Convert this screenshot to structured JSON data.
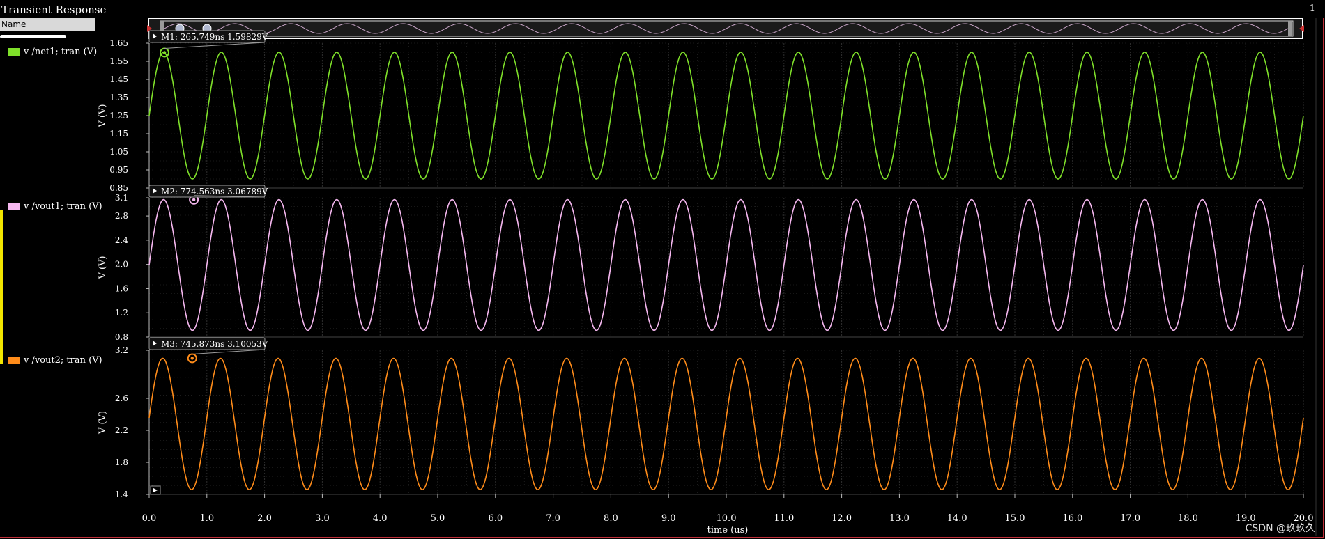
{
  "window": {
    "title": "Transient Response",
    "number": "1"
  },
  "panel": {
    "name_header": "Name"
  },
  "legend": [
    {
      "label": "v /net1; tran (V)",
      "color": "#7fe02a"
    },
    {
      "label": "v /vout1; tran (V)",
      "color": "#f6b8f0"
    },
    {
      "label": "v /vout2; tran (V)",
      "color": "#ff8c1a"
    }
  ],
  "watermark": "CSDN @玖玖久",
  "colors": {
    "grid": "#2e2e2e",
    "axis": "#bdbdbd",
    "frame": "#c0303a",
    "selection": "#f2e600"
  },
  "chart_data": {
    "type": "line",
    "xlabel": "time (us)",
    "xlim": [
      0.0,
      20.0
    ],
    "x_ticks": [
      "0.0",
      "1.0",
      "2.0",
      "3.0",
      "4.0",
      "5.0",
      "6.0",
      "7.0",
      "8.0",
      "9.0",
      "10.0",
      "11.0",
      "12.0",
      "13.0",
      "14.0",
      "15.0",
      "16.0",
      "17.0",
      "18.0",
      "19.0",
      "20.0"
    ],
    "x_tick_values": [
      0,
      1,
      2,
      3,
      4,
      5,
      6,
      7,
      8,
      9,
      10,
      11,
      12,
      13,
      14,
      15,
      16,
      17,
      18,
      19,
      20
    ],
    "grid": true,
    "panels": [
      {
        "ylabel": "V (V)",
        "ylim": [
          0.85,
          1.65
        ],
        "y_ticks": [
          "1.65",
          "1.55",
          "1.45",
          "1.35",
          "1.25",
          "1.15",
          "1.05",
          "0.95",
          "0.85"
        ],
        "y_tick_values": [
          1.65,
          1.55,
          1.45,
          1.35,
          1.25,
          1.15,
          1.05,
          0.95,
          0.85
        ],
        "series": {
          "color": "#7fe02a",
          "offset": 1.25,
          "amplitude": 0.35,
          "period_us": 1.0,
          "phase_us": 0.0
        },
        "marker": {
          "label": "M1: 265.749ns 1.59829V",
          "x_us": 0.265749,
          "y": 1.59829
        }
      },
      {
        "ylabel": "V (V)",
        "ylim": [
          0.8,
          3.1
        ],
        "y_ticks": [
          "3.1",
          "2.8",
          "2.4",
          "2.0",
          "1.6",
          "1.2",
          "0.8"
        ],
        "y_tick_values": [
          3.1,
          2.8,
          2.4,
          2.0,
          1.6,
          1.2,
          0.8
        ],
        "series": {
          "color": "#f6b8f0",
          "offset": 1.99,
          "amplitude": 1.08,
          "period_us": 1.0,
          "phase_us": 0.0
        },
        "marker": {
          "label": "M2: 774.563ns 3.06789V",
          "x_us": 0.774563,
          "y": 3.06789
        }
      },
      {
        "ylabel": "V (V)",
        "ylim": [
          1.4,
          3.2
        ],
        "y_ticks": [
          "3.2",
          "2.6",
          "2.2",
          "1.8",
          "1.4"
        ],
        "y_tick_values": [
          3.2,
          2.6,
          2.2,
          1.8,
          1.4
        ],
        "series": {
          "color": "#ff8c1a",
          "offset": 2.28,
          "amplitude": 0.82,
          "period_us": 1.0,
          "phase_us": -0.015
        },
        "marker": {
          "label": "M3: 745.873ns 3.10053V",
          "x_us": 0.745873,
          "y": 3.10053
        }
      }
    ]
  }
}
